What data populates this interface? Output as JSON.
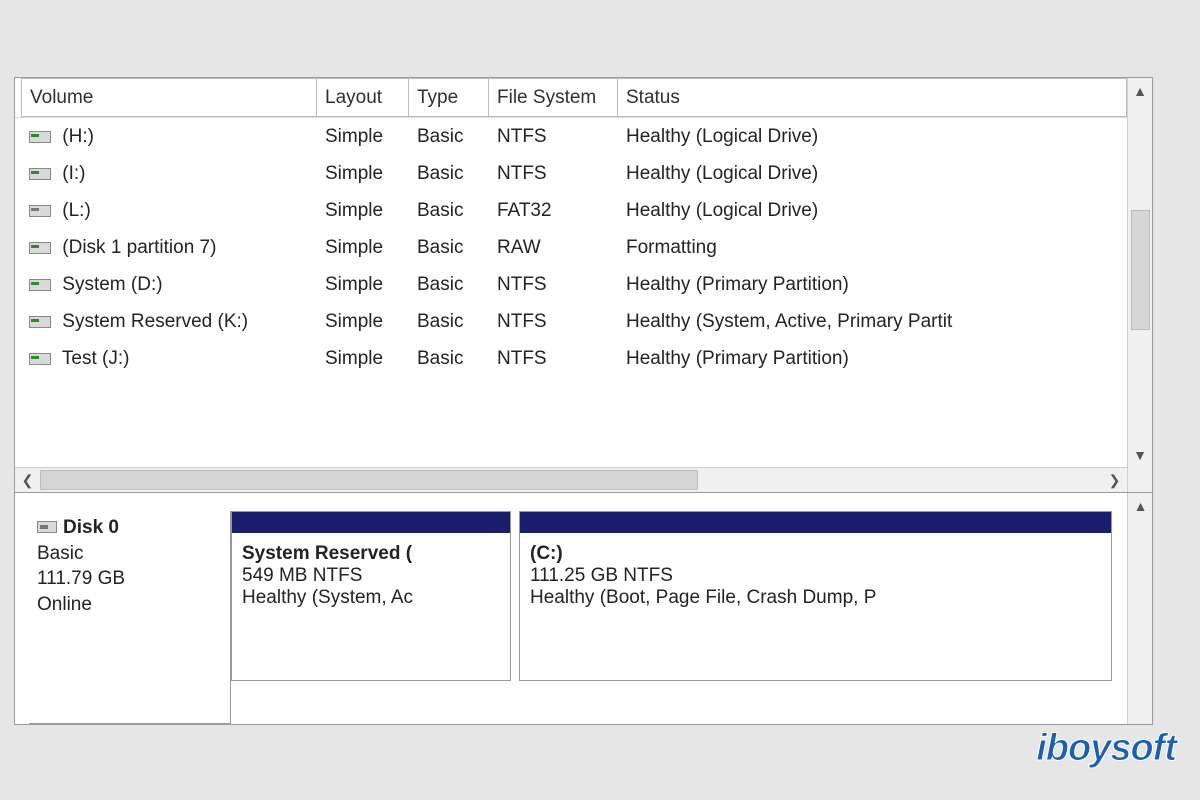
{
  "columns": {
    "volume": "Volume",
    "layout": "Layout",
    "type": "Type",
    "filesystem": "File System",
    "status": "Status"
  },
  "volumes": [
    {
      "icon": "green",
      "name": " (H:)",
      "layout": "Simple",
      "type": "Basic",
      "fs": "NTFS",
      "status": "Healthy (Logical Drive)"
    },
    {
      "icon": "green",
      "name": " (I:)",
      "layout": "Simple",
      "type": "Basic",
      "fs": "NTFS",
      "status": "Healthy (Logical Drive)"
    },
    {
      "icon": "gray",
      "name": " (L:)",
      "layout": "Simple",
      "type": "Basic",
      "fs": "FAT32",
      "status": "Healthy (Logical Drive)"
    },
    {
      "icon": "green",
      "name": " (Disk 1 partition 7)",
      "layout": "Simple",
      "type": "Basic",
      "fs": "RAW",
      "status": "Formatting"
    },
    {
      "icon": "green",
      "name": " System (D:)",
      "layout": "Simple",
      "type": "Basic",
      "fs": "NTFS",
      "status": "Healthy (Primary Partition)"
    },
    {
      "icon": "green",
      "name": " System Reserved (K:)",
      "layout": "Simple",
      "type": "Basic",
      "fs": "NTFS",
      "status": "Healthy (System, Active, Primary Partit"
    },
    {
      "icon": "green",
      "name": " Test (J:)",
      "layout": "Simple",
      "type": "Basic",
      "fs": "NTFS",
      "status": "Healthy (Primary Partition)"
    }
  ],
  "disk": {
    "title": "Disk 0",
    "type": "Basic",
    "size": "111.79 GB",
    "state": "Online"
  },
  "partitions": [
    {
      "name": "System Reserved  (",
      "size": "549 MB NTFS",
      "status": "Healthy (System, Ac"
    },
    {
      "name": "(C:)",
      "size": "111.25 GB NTFS",
      "status": "Healthy (Boot, Page File, Crash Dump, P"
    }
  ],
  "watermark": "iBoysoft"
}
